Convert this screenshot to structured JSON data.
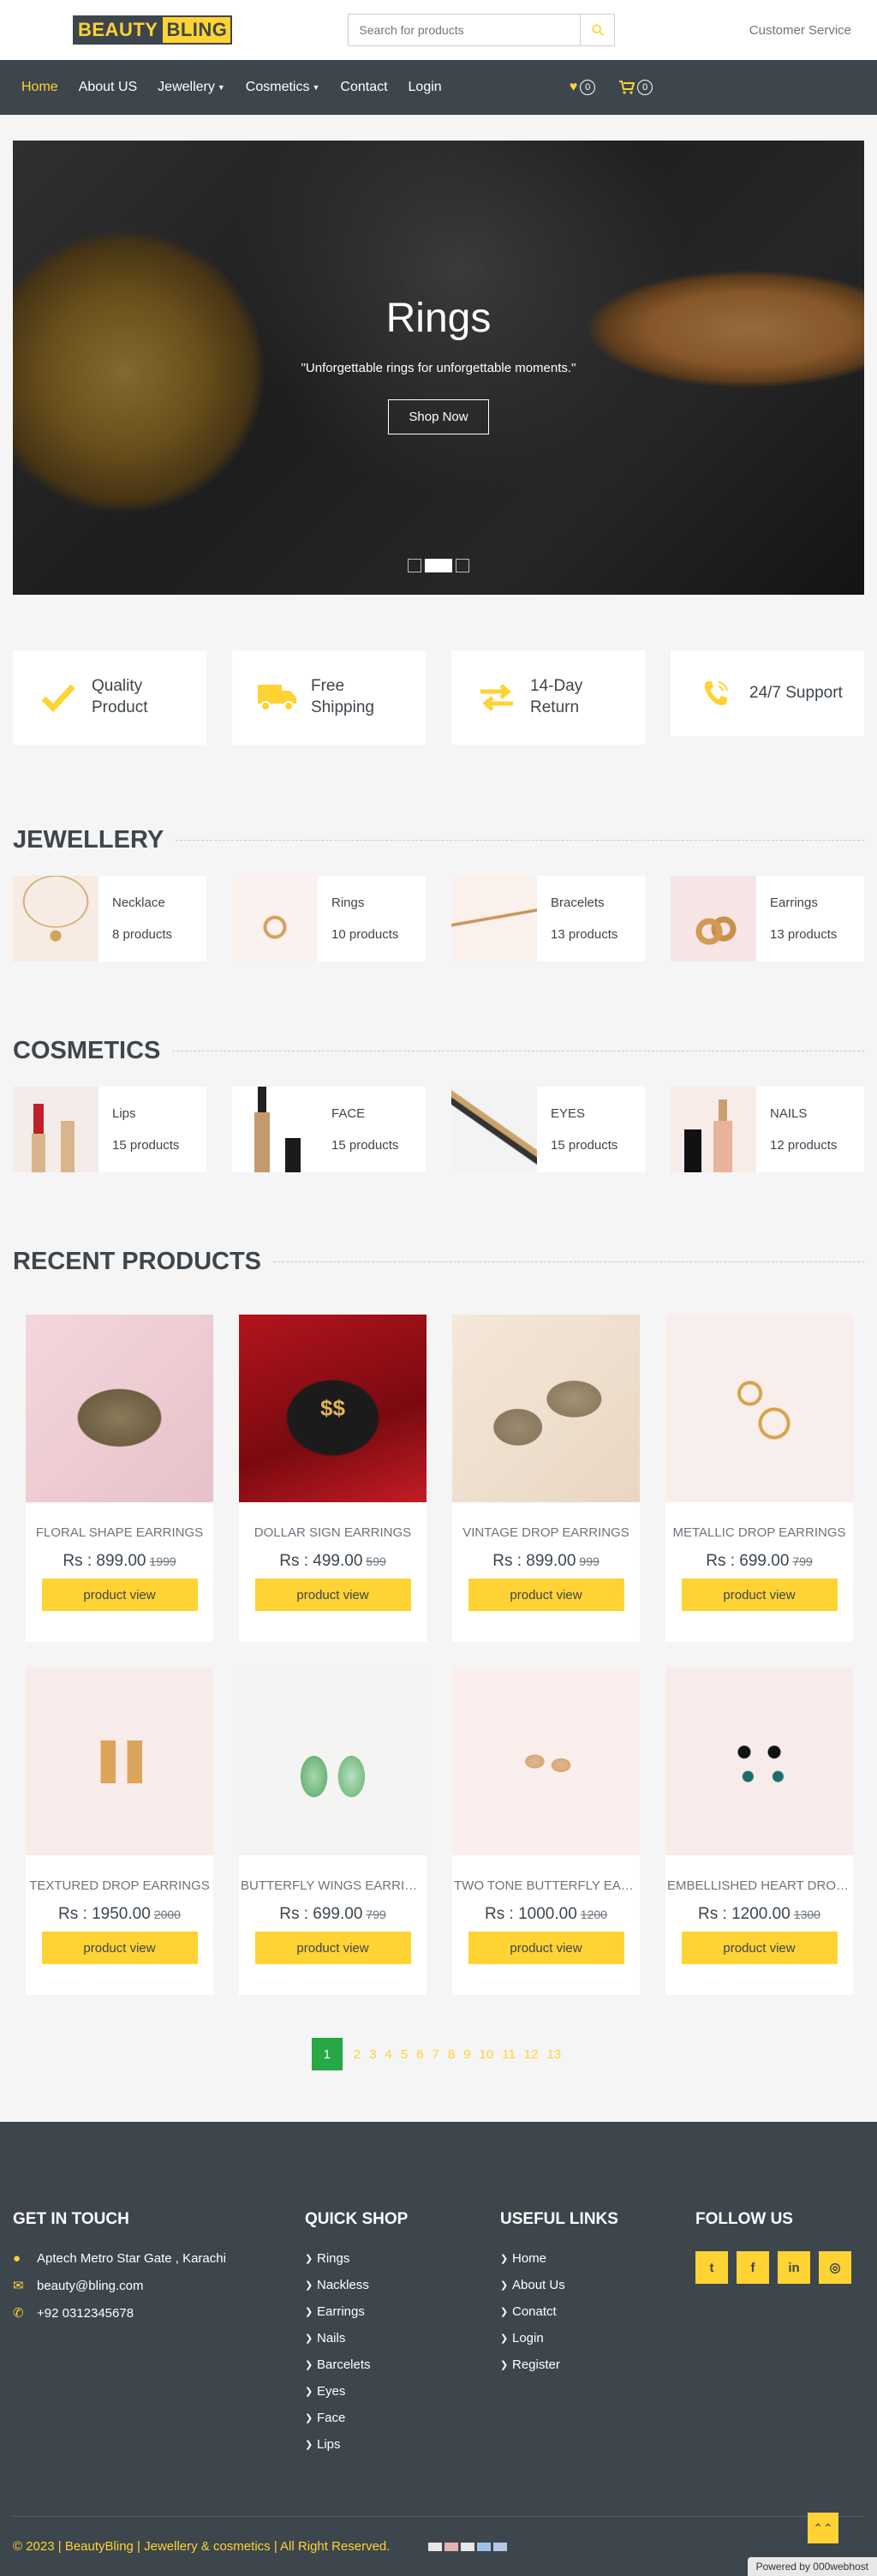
{
  "brand": {
    "part1": "BEAUTY",
    "part2": "BLING"
  },
  "search": {
    "placeholder": "Search for products",
    "icon": "search-icon"
  },
  "header": {
    "customer_service": "Customer Service"
  },
  "nav": {
    "links": [
      "Home",
      "About US",
      "Jewellery",
      "Cosmetics",
      "Contact",
      "Login"
    ],
    "wishlist_count": "0",
    "cart_count": "0"
  },
  "hero": {
    "title": "Rings",
    "subtitle": "\"Unforgettable rings for unforgettable moments.\"",
    "button": "Shop Now",
    "active_slide": 2,
    "slides": 3
  },
  "features": [
    {
      "icon": "check-icon",
      "line1": "Quality",
      "line2": "Product"
    },
    {
      "icon": "truck-icon",
      "line1": "Free",
      "line2": "Shipping"
    },
    {
      "icon": "exchange-icon",
      "line1": "14-Day",
      "line2": "Return"
    },
    {
      "icon": "phone-volume-icon",
      "line1": "24/7 Support",
      "line2": ""
    }
  ],
  "jewellery": {
    "title": "JEWELLERY",
    "categories": [
      {
        "name": "Necklace",
        "count": "8 products"
      },
      {
        "name": "Rings",
        "count": "10 products"
      },
      {
        "name": "Bracelets",
        "count": "13 products"
      },
      {
        "name": "Earrings",
        "count": "13 products"
      }
    ]
  },
  "cosmetics": {
    "title": "COSMETICS",
    "categories": [
      {
        "name": "Lips",
        "count": "15 products"
      },
      {
        "name": "FACE",
        "count": "15 products"
      },
      {
        "name": "EYES",
        "count": "15 products"
      },
      {
        "name": "NAILS",
        "count": "12 products"
      }
    ]
  },
  "recent": {
    "title": "RECENT PRODUCTS",
    "button": "product view",
    "products": [
      {
        "name": "FLORAL SHAPE EARRINGS",
        "price": "Rs : 899.00",
        "old": "1999"
      },
      {
        "name": "DOLLAR SIGN EARRINGS",
        "price": "Rs : 499.00",
        "old": "599"
      },
      {
        "name": "VINTAGE DROP EARRINGS",
        "price": "Rs : 899.00",
        "old": "999"
      },
      {
        "name": "METALLIC DROP EARRINGS",
        "price": "Rs : 699.00",
        "old": "799"
      },
      {
        "name": "TEXTURED DROP EARRINGS",
        "price": "Rs : 1950.00",
        "old": "2000"
      },
      {
        "name": "BUTTERFLY WINGS EARRINGS",
        "price": "Rs : 699.00",
        "old": "799"
      },
      {
        "name": "TWO TONE BUTTERFLY EARRINGS",
        "price": "Rs : 1000.00",
        "old": "1200"
      },
      {
        "name": "EMBELLISHED HEART DROP EARRINGS",
        "price": "Rs : 1200.00",
        "old": "1300"
      }
    ]
  },
  "pagination": [
    "1",
    "2",
    "3",
    "4",
    "5",
    "6",
    "7",
    "8",
    "9",
    "10",
    "11",
    "12",
    "13"
  ],
  "footer": {
    "touch_title": "GET IN TOUCH",
    "address": "Aptech Metro Star Gate , Karachi",
    "email": "beauty@bling.com",
    "phone": "+92 0312345678",
    "quick_title": "QUICK SHOP",
    "quick": [
      "Rings",
      "Nackless",
      "Earrings",
      "Nails",
      "Barcelets",
      "Eyes",
      "Face",
      "Lips"
    ],
    "useful_title": "USEFUL LINKS",
    "useful": [
      "Home",
      "About Us",
      "Conatct",
      "Login",
      "Register"
    ],
    "follow_title": "FOLLOW US",
    "copy_year": "© 2023",
    "copy_rest": " | BeautyBling | Jewellery & cosmetics | All Right Reserved.",
    "powered": "Powered by 000webhost"
  },
  "colors": {
    "accent": "#ffd333",
    "dark": "#3d464d",
    "active_page": "#28a745"
  }
}
